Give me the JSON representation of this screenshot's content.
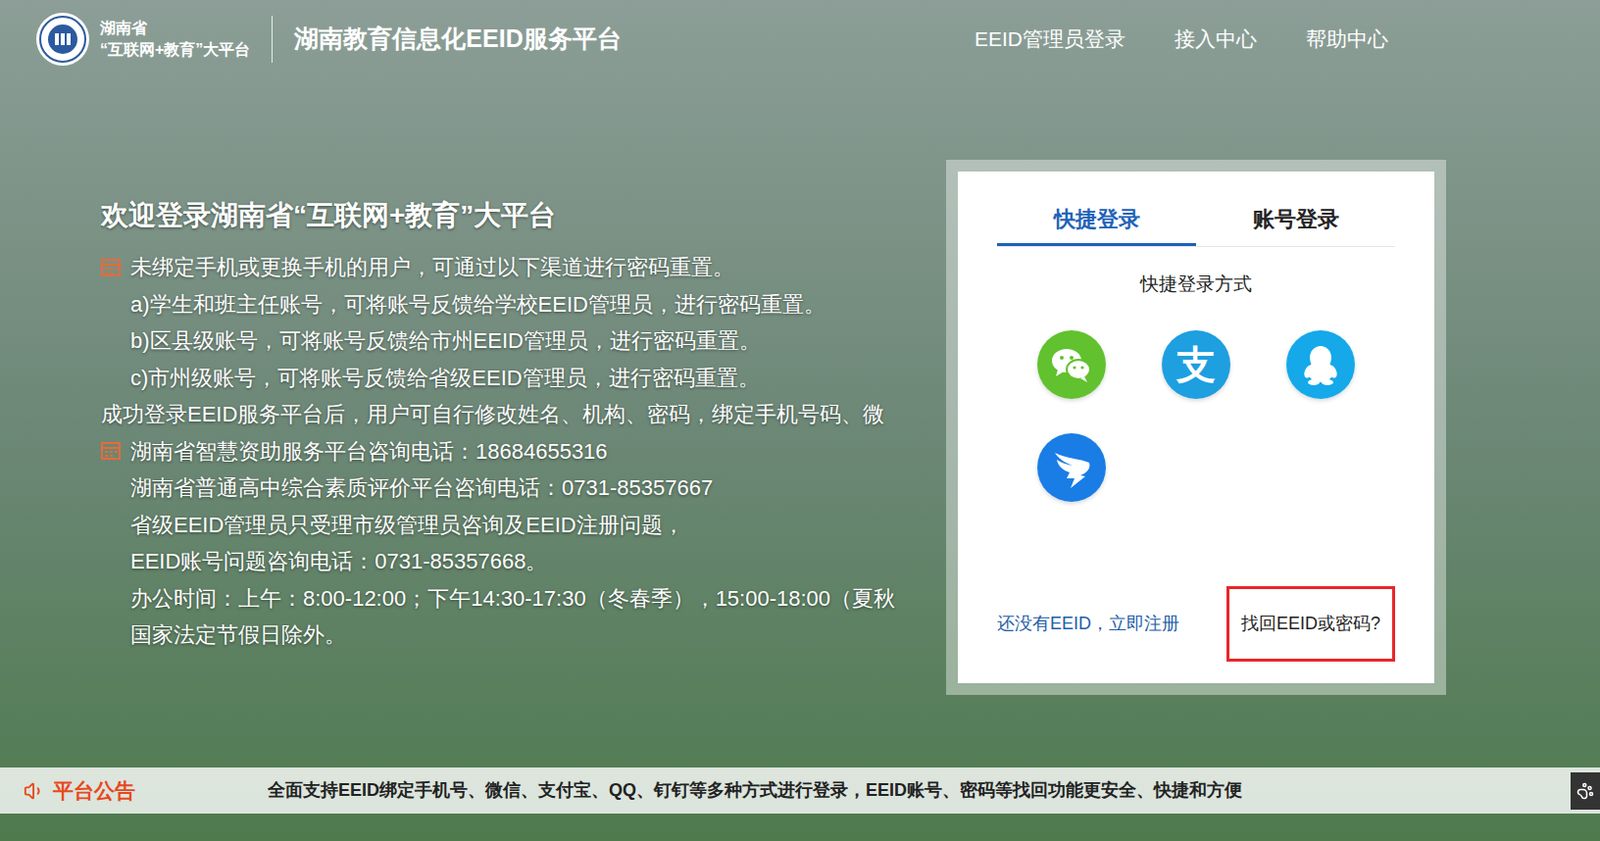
{
  "header": {
    "org_line1": "湖南省",
    "org_line2": "“互联网+教育”大平台",
    "title": "湖南教育信息化EEID服务平台",
    "nav": [
      "EEID管理员登录",
      "接入中心",
      "帮助中心"
    ]
  },
  "welcome": {
    "heading": "欢迎登录湖南省“互联网+教育”大平台",
    "lines": [
      {
        "text": "未绑定手机或更换手机的用户，可通过以下渠道进行密码重置。",
        "kind": "bullet"
      },
      {
        "text": "a)学生和班主任账号，可将账号反馈给学校EEID管理员，进行密码重置。",
        "kind": "indent"
      },
      {
        "text": "b)区县级账号，可将账号反馈给市州EEID管理员，进行密码重置。",
        "kind": "indent"
      },
      {
        "text": "c)市州级账号，可将账号反馈给省级EEID管理员，进行密码重置。",
        "kind": "indent"
      },
      {
        "text": "成功登录EEID服务平台后，用户可自行修改姓名、机构、密码，绑定手机号码、微",
        "kind": "plain"
      },
      {
        "text": "湖南省智慧资助服务平台咨询电话：18684655316",
        "kind": "bullet"
      },
      {
        "text": "湖南省普通高中综合素质评价平台咨询电话：0731-85357667",
        "kind": "indent"
      },
      {
        "text": "省级EEID管理员只受理市级管理员咨询及EEID注册问题，",
        "kind": "indent"
      },
      {
        "text": "EEID账号问题咨询电话：0731-85357668。",
        "kind": "indent"
      },
      {
        "text": "办公时间：上午：8:00-12:00；下午14:30-17:30（冬春季），15:00-18:00（夏秋",
        "kind": "indent"
      },
      {
        "text": "国家法定节假日除外。",
        "kind": "indent"
      }
    ]
  },
  "login": {
    "tabs": [
      {
        "label": "快捷登录",
        "selected": true
      },
      {
        "label": "账号登录",
        "selected": false
      }
    ],
    "methods_title": "快捷登录方式",
    "methods": [
      {
        "kind": "wechat",
        "color": "#62c12e"
      },
      {
        "kind": "alipay",
        "color": "#1d9fe0",
        "glyph": "支"
      },
      {
        "kind": "qq",
        "color": "#15a9ea"
      },
      {
        "kind": "dingtalk",
        "color": "#1a7de6"
      }
    ],
    "links": [
      {
        "text": "还没有EEID，立即注册",
        "highlighted": false
      },
      {
        "text": "找回EEID或密码?",
        "highlighted": true
      }
    ]
  },
  "announcement": {
    "label": "平台公告",
    "text": "全面支持EEID绑定手机号、微信、支付宝、QQ、钉钉等多种方式进行登录，EEID账号、密码等找回功能更安全、快捷和方便"
  }
}
